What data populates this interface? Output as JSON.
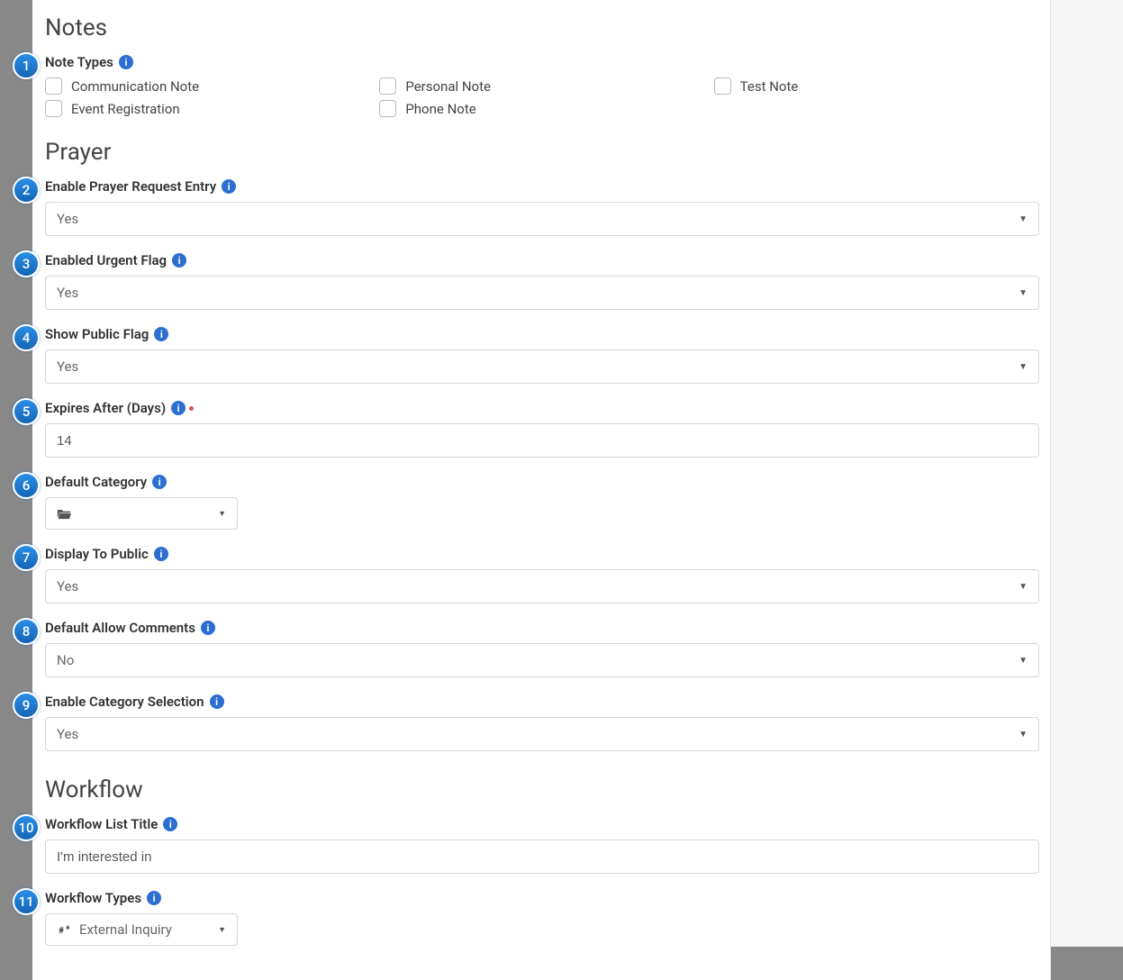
{
  "notes": {
    "section_title": "Notes",
    "note_types_label": "Note Types",
    "options": [
      "Communication Note",
      "Personal Note",
      "Test Note",
      "Event Registration",
      "Phone Note"
    ]
  },
  "prayer": {
    "section_title": "Prayer",
    "enable_entry": {
      "label": "Enable Prayer Request Entry",
      "value": "Yes"
    },
    "urgent_flag": {
      "label": "Enabled Urgent Flag",
      "value": "Yes"
    },
    "public_flag": {
      "label": "Show Public Flag",
      "value": "Yes"
    },
    "expires": {
      "label": "Expires After (Days)",
      "value": "14"
    },
    "default_category": {
      "label": "Default Category",
      "value": ""
    },
    "display_public": {
      "label": "Display To Public",
      "value": "Yes"
    },
    "allow_comments": {
      "label": "Default Allow Comments",
      "value": "No"
    },
    "category_select": {
      "label": "Enable Category Selection",
      "value": "Yes"
    }
  },
  "workflow": {
    "section_title": "Workflow",
    "list_title": {
      "label": "Workflow List Title",
      "value": "I'm interested in"
    },
    "types": {
      "label": "Workflow Types",
      "value": "External Inquiry"
    }
  },
  "badges": [
    "1",
    "2",
    "3",
    "4",
    "5",
    "6",
    "7",
    "8",
    "9",
    "10",
    "11"
  ],
  "info_char": "i"
}
